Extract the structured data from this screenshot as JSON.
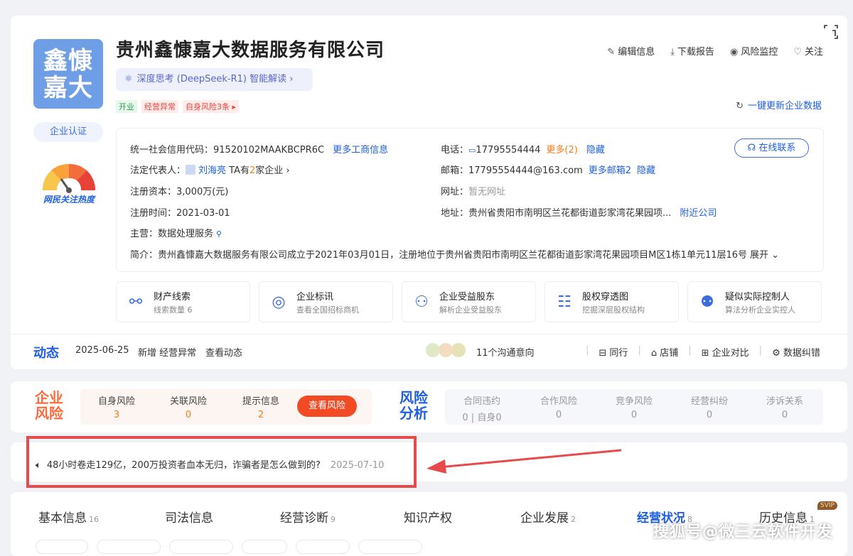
{
  "company": {
    "logo_text": "鑫慷嘉大",
    "name": "贵州鑫慷嘉大数据服务有限公司",
    "ai_label": "深度思考 (DeepSeek-R1) 智能解读 ›",
    "tags": [
      "开业",
      "经营异常",
      "自身风险3条 ▸"
    ],
    "auth_label": "企业认证",
    "heat_label": "网民关注热度"
  },
  "actions": [
    "编辑信息",
    "下载报告",
    "风险监控",
    "关注"
  ],
  "refresh_label": "一键更新企业数据",
  "info": {
    "credit_label": "统一社会信用代码：",
    "credit_code": "91520102MAAKBCPR6C",
    "credit_more": "更多工商信息",
    "legal_label": "法定代表人：",
    "legal_name": "刘海亮",
    "legal_ta": "TA有",
    "legal_count": "2",
    "legal_suffix": "家企业 ›",
    "capital_label": "注册资本：",
    "capital": "3,000万(元)",
    "date_label": "注册时间：",
    "date": "2021-03-01",
    "business_label": "主营：",
    "business": "数据处理服务",
    "intro_label": "简介：",
    "intro": "贵州鑫慷嘉大数据服务有限公司成立于2021年03月01日，注册地位于贵州省贵阳市南明区兰花都街道彭家湾花果园项目M区1栋1单元11层16号",
    "intro_expand": "展开 ⌄",
    "phone_label": "电话：",
    "phone": "17795554444",
    "phone_more": "更多(2)",
    "phone_hide": "隐藏",
    "email_label": "邮箱：",
    "email": "17795554444@163.com",
    "email_more": "更多邮箱2",
    "email_hide": "隐藏",
    "web_label": "网址：",
    "web": "暂无网址",
    "addr_label": "地址：",
    "addr": "贵州省贵阳市南明区兰花都街道彭家湾花果园项...",
    "addr_near": "附近公司",
    "contact_btn": "在线联系"
  },
  "tools": [
    {
      "title": "财产线索",
      "sub": "线索数量 6"
    },
    {
      "title": "企业标讯",
      "sub": "查看全国招标商机"
    },
    {
      "title": "企业受益股东",
      "sub": "解析企业受益股东"
    },
    {
      "title": "股权穿透图",
      "sub": "挖掘深层股权结构"
    },
    {
      "title": "疑似实际控制人",
      "sub": "算法分析企业实控人"
    }
  ],
  "dynamic": {
    "label": "动态",
    "date": "2025-06-25",
    "text": "新增 经营异常",
    "link": "查看动态",
    "intent": "11个沟通意向",
    "links": [
      "同行",
      "店铺",
      "企业对比",
      "数据纠错"
    ]
  },
  "risk": {
    "label1": "企业",
    "label2": "风险",
    "items": [
      {
        "name": "自身风险",
        "value": "3"
      },
      {
        "name": "关联风险",
        "value": "0"
      },
      {
        "name": "提示信息",
        "value": "2"
      }
    ],
    "button": "查看风险",
    "analysis1": "风险",
    "analysis2": "分析",
    "analysis": [
      {
        "name": "合同违约",
        "value": "0 | 自身0"
      },
      {
        "name": "合作风险",
        "value": "0"
      },
      {
        "name": "竞争风险",
        "value": "0"
      },
      {
        "name": "经营纠纷",
        "value": "0"
      },
      {
        "name": "涉诉关系",
        "value": "0"
      }
    ]
  },
  "notice": {
    "text": "48小时卷走129亿，200万投资者血本无归，诈骗者是怎么做到的?",
    "date": "2025-07-10"
  },
  "tabs": [
    {
      "label": "基本信息",
      "count": "16"
    },
    {
      "label": "司法信息",
      "count": ""
    },
    {
      "label": "经营诊断",
      "count": "9"
    },
    {
      "label": "知识产权",
      "count": ""
    },
    {
      "label": "企业发展",
      "count": "2"
    },
    {
      "label": "经营状况",
      "count": "8"
    },
    {
      "label": "历史信息",
      "count": "1"
    }
  ],
  "svip": "SVIP",
  "watermark": "搜狐号@微三云软件开发"
}
